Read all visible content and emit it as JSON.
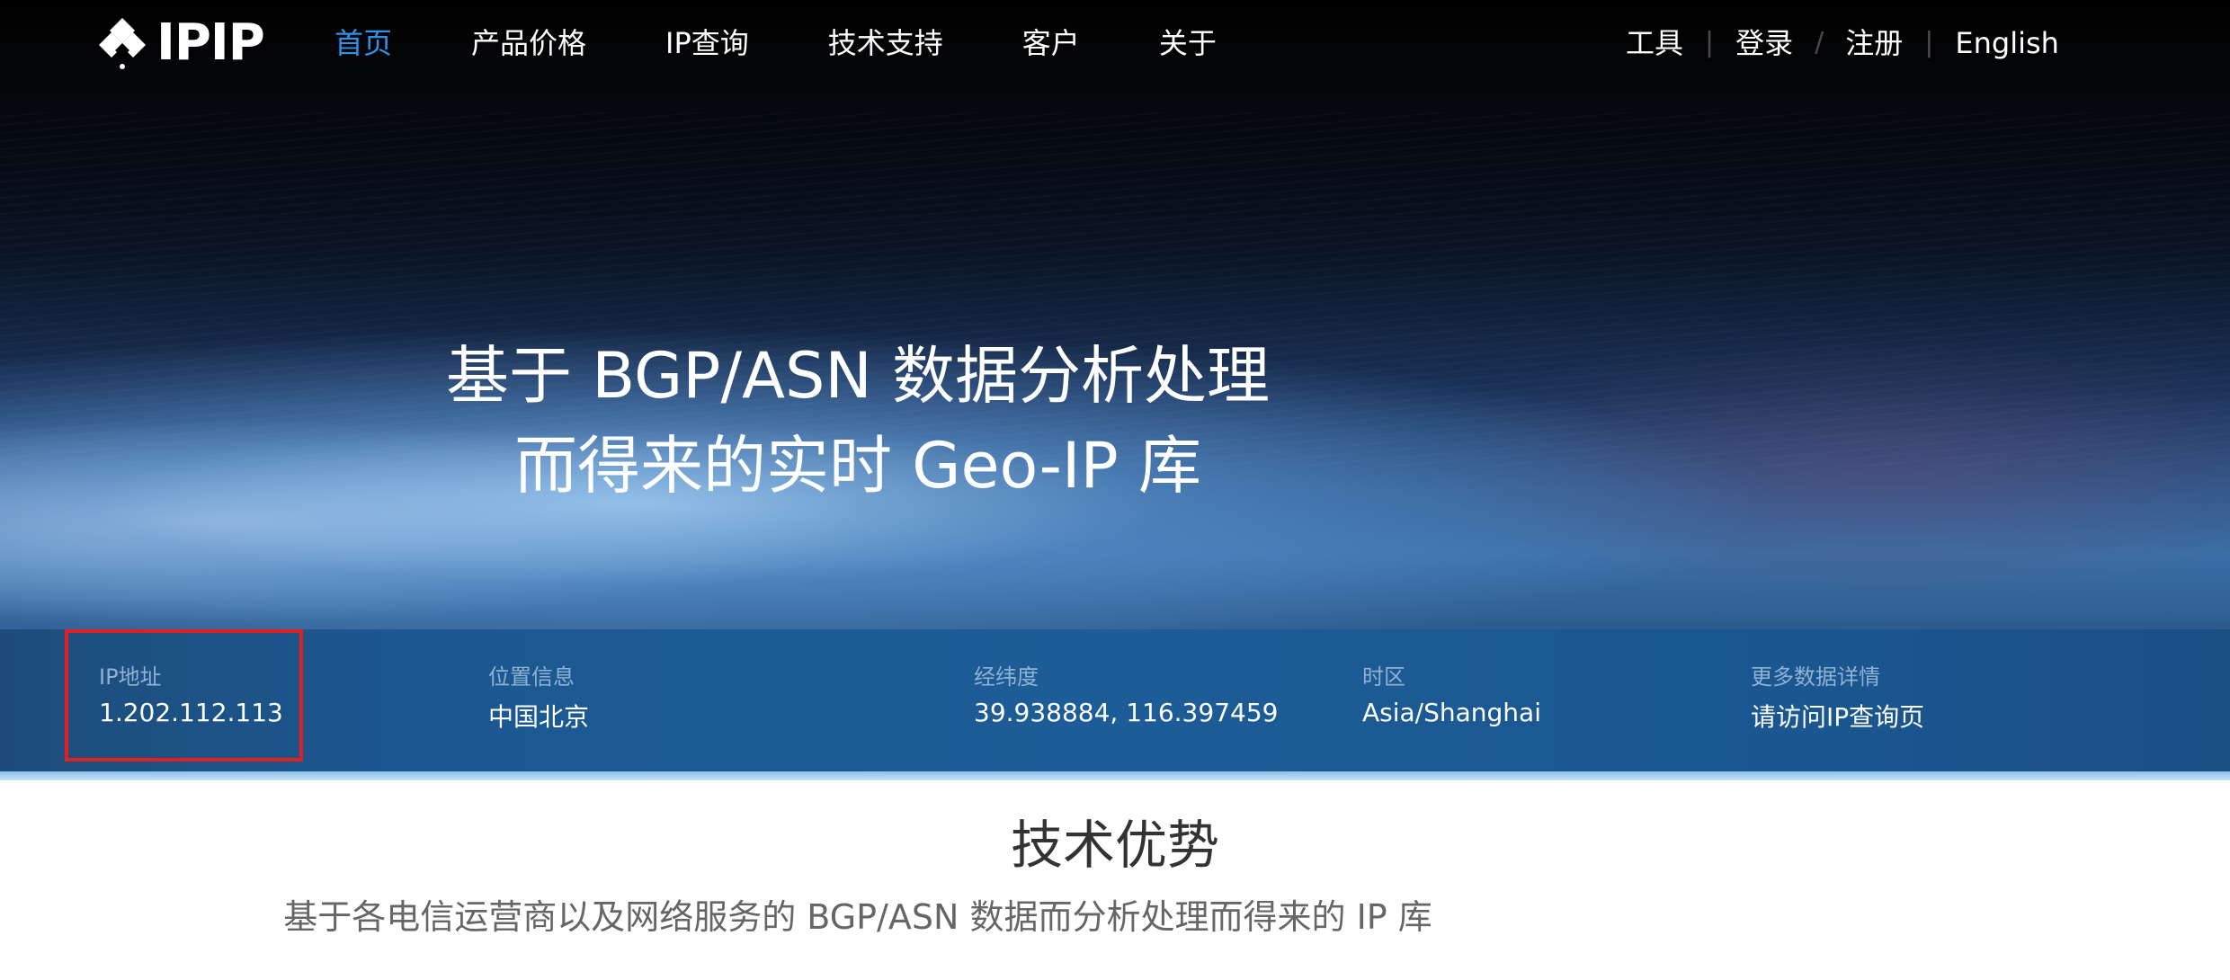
{
  "header": {
    "logo_text": "IPIP",
    "nav": [
      "首页",
      "产品价格",
      "IP查询",
      "技术支持",
      "客户",
      "关于"
    ],
    "right": {
      "tools": "工具",
      "login": "登录",
      "register": "注册",
      "language": "English"
    }
  },
  "hero": {
    "line1": "基于 BGP/ASN 数据分析处理",
    "line2": "而得来的实时 Geo-IP 库"
  },
  "info": {
    "ip": {
      "label": "IP地址",
      "value": "1.202.112.113"
    },
    "location": {
      "label": "位置信息",
      "value": "中国北京"
    },
    "coords": {
      "label": "经纬度",
      "value": "39.938884, 116.397459"
    },
    "timezone": {
      "label": "时区",
      "value": "Asia/Shanghai"
    },
    "more": {
      "label": "更多数据详情",
      "value": "请访问IP查询页"
    }
  },
  "section": {
    "title": "技术优势",
    "subtitle": "基于各电信运营商以及网络服务的 BGP/ASN 数据而分析处理而得来的 IP 库"
  },
  "colors": {
    "nav_active": "#2e93e8",
    "highlight": "#e02020"
  }
}
